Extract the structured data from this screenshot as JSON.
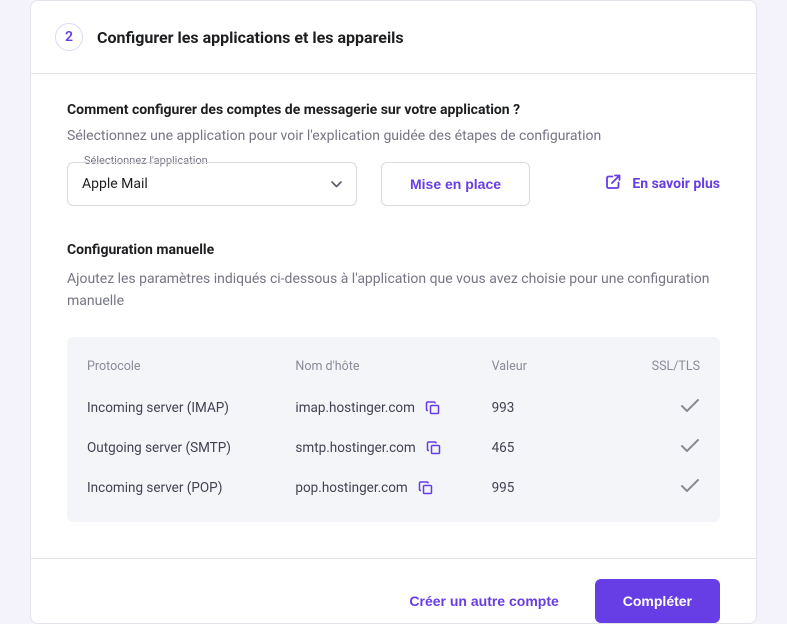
{
  "step": {
    "number": "2",
    "title": "Configurer les applications et les appareils"
  },
  "question": {
    "title": "Comment configurer des comptes de messagerie sur votre application ?",
    "desc": "Sélectionnez une application pour voir l'explication guidée des étapes de configuration"
  },
  "select": {
    "label": "Sélectionnez l'application",
    "value": "Apple Mail"
  },
  "buttons": {
    "setup": "Mise en place",
    "learn_more": "En savoir plus",
    "create_another": "Créer un autre compte",
    "complete": "Compléter"
  },
  "manual": {
    "title": "Configuration manuelle",
    "desc": "Ajoutez les paramètres indiqués ci-dessous à l'application que vous avez choisie pour une configuration manuelle"
  },
  "table": {
    "headers": {
      "protocol": "Protocole",
      "host": "Nom d'hôte",
      "value": "Valeur",
      "ssl": "SSL/TLS"
    },
    "rows": [
      {
        "protocol": "Incoming server (IMAP)",
        "host": "imap.hostinger.com",
        "value": "993"
      },
      {
        "protocol": "Outgoing server (SMTP)",
        "host": "smtp.hostinger.com",
        "value": "465"
      },
      {
        "protocol": "Incoming server (POP)",
        "host": "pop.hostinger.com",
        "value": "995"
      }
    ]
  }
}
